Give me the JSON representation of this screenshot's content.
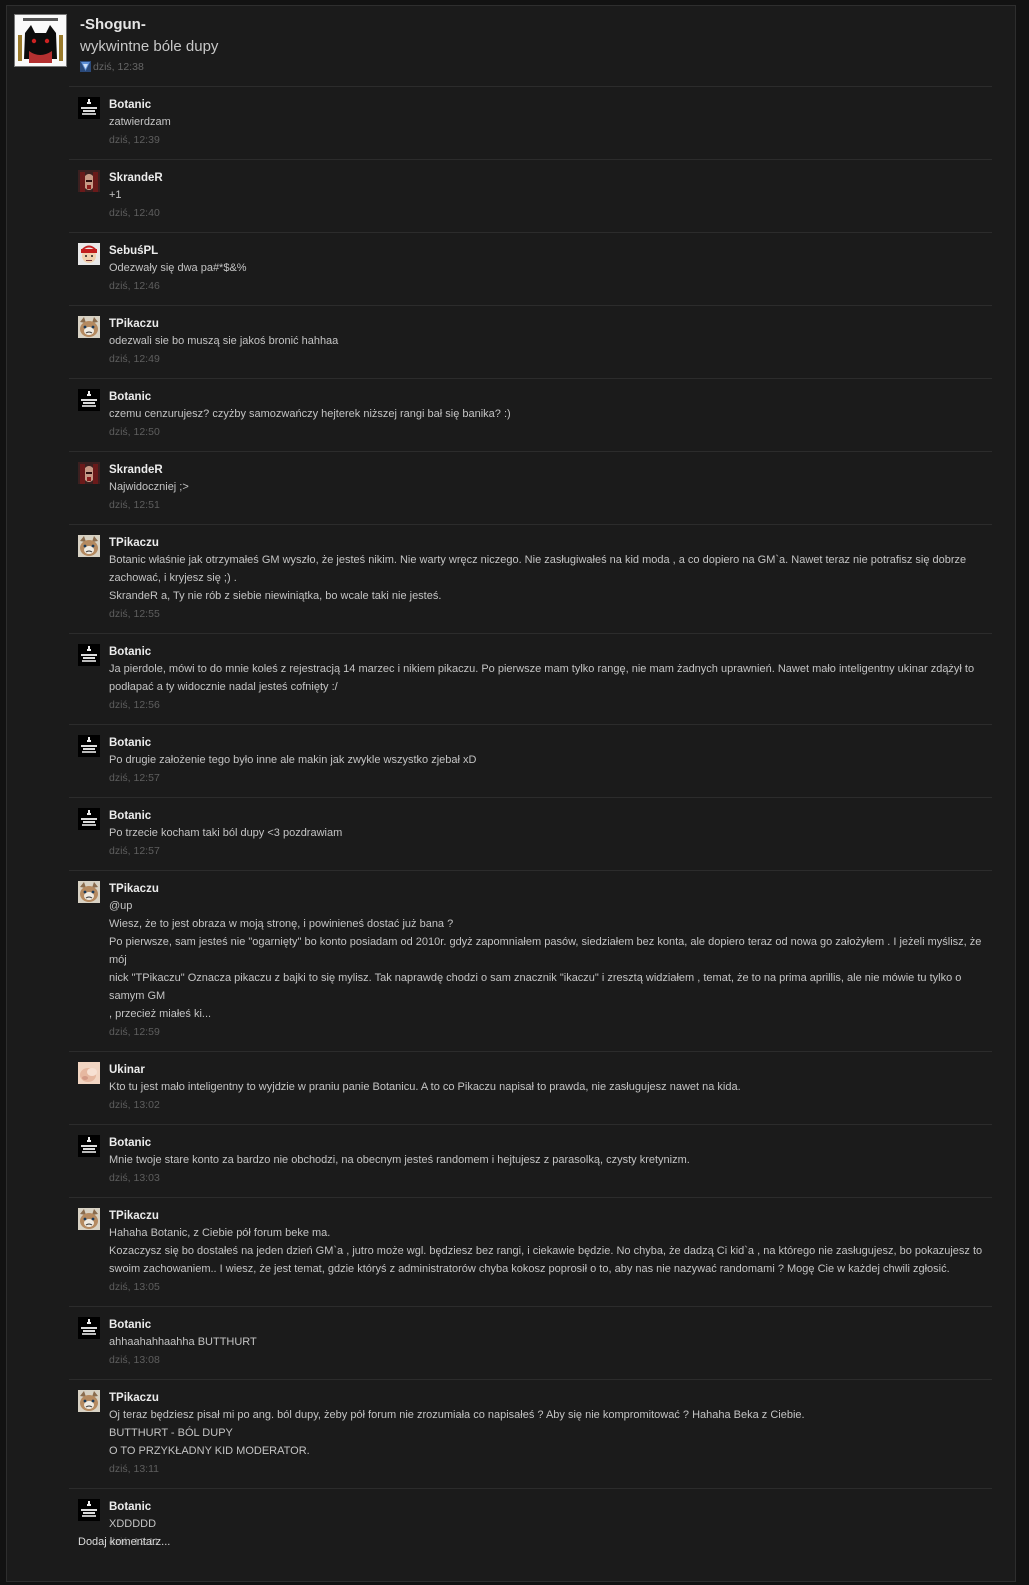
{
  "status": {
    "author": "-Shogun-",
    "text": "wykwintne bóle dupy",
    "time": "dziś, 12:38",
    "avatar_icon": "shogun-avatar-icon"
  },
  "comments": [
    {
      "author": "Botanic",
      "avatar": "botanic",
      "lines": [
        "zatwierdzam"
      ],
      "time": "dziś, 12:39"
    },
    {
      "author": "SkrandeR",
      "avatar": "skrander",
      "lines": [
        "+1"
      ],
      "time": "dziś, 12:40"
    },
    {
      "author": "SebuśPL",
      "avatar": "sebus",
      "lines": [
        "Odezwały się dwa pa#*$&%"
      ],
      "time": "dziś, 12:46"
    },
    {
      "author": "TPikaczu",
      "avatar": "tpikaczu",
      "lines": [
        "odezwali sie bo muszą sie jakoś bronić hahhaa"
      ],
      "time": "dziś, 12:49"
    },
    {
      "author": "Botanic",
      "avatar": "botanic",
      "lines": [
        "czemu cenzurujesz? czyżby samozwańczy hejterek niższej rangi bał się banika? :)"
      ],
      "time": "dziś, 12:50"
    },
    {
      "author": "SkrandeR",
      "avatar": "skrander",
      "lines": [
        "Najwidoczniej ;>"
      ],
      "time": "dziś, 12:51"
    },
    {
      "author": "TPikaczu",
      "avatar": "tpikaczu",
      "lines": [
        "Botanic właśnie jak otrzymałeś GM wyszło, że jesteś nikim. Nie warty wręcz niczego. Nie zasługiwałeś na kid moda , a co dopiero na GM`a. Nawet teraz nie potrafisz się dobrze",
        "zachować, i kryjesz się ;) .",
        "SkrandeR a, Ty nie rób z siebie niewiniątka, bo wcale taki nie jesteś."
      ],
      "time": "dziś, 12:55"
    },
    {
      "author": "Botanic",
      "avatar": "botanic",
      "lines": [
        "Ja pierdole, mówi to do mnie koleś z rejestracją 14 marzec i nikiem pikaczu. Po pierwsze mam tylko rangę, nie mam żadnych uprawnień. Nawet mało inteligentny ukinar zdążył to",
        "podłapać a ty widocznie nadal jesteś cofnięty :/"
      ],
      "time": "dziś, 12:56"
    },
    {
      "author": "Botanic",
      "avatar": "botanic",
      "lines": [
        "Po drugie założenie tego było inne ale makin jak zwykle wszystko zjebał xD"
      ],
      "time": "dziś, 12:57"
    },
    {
      "author": "Botanic",
      "avatar": "botanic",
      "lines": [
        "Po trzecie kocham taki ból dupy <3 pozdrawiam"
      ],
      "time": "dziś, 12:57"
    },
    {
      "author": "TPikaczu",
      "avatar": "tpikaczu",
      "lines": [
        "@up",
        "Wiesz, że to jest obraza w moją stronę, i powinieneś dostać już bana ?",
        "Po pierwsze, sam jesteś nie \"ogarnięty\" bo konto posiadam od 2010r. gdyż zapomniałem pasów, siedziałem bez konta, ale dopiero teraz od nowa go założyłem . I jeżeli myślisz, że mój",
        "nick \"TPikaczu\" Oznacza pikaczu z bajki to się mylisz. Tak naprawdę chodzi o sam znacznik \"ikaczu\" i zresztą widziałem , temat, że to na prima aprillis, ale nie mówie tu tylko o samym GM",
        ", przecież miałeś ki..."
      ],
      "time": "dziś, 12:59"
    },
    {
      "author": "Ukinar",
      "avatar": "ukinar",
      "lines": [
        "Kto tu jest mało inteligentny to wyjdzie w praniu panie Botanicu. A to co Pikaczu napisał to prawda, nie zasługujesz nawet na kida."
      ],
      "time": "dziś, 13:02"
    },
    {
      "author": "Botanic",
      "avatar": "botanic",
      "lines": [
        "Mnie twoje stare konto za bardzo nie obchodzi, na obecnym jesteś randomem i hejtujesz z parasolką, czysty kretynizm."
      ],
      "time": "dziś, 13:03"
    },
    {
      "author": "TPikaczu",
      "avatar": "tpikaczu",
      "lines": [
        "Hahaha Botanic, z Ciebie pół forum beke ma.",
        "Kozaczysz się bo dostałeś na jeden dzień GM`a , jutro może wgl. będziesz bez rangi, i ciekawie będzie. No chyba, że dadzą Ci kid`a , na którego nie zasługujesz, bo pokazujesz to",
        "swoim zachowaniem.. I wiesz, że jest temat, gdzie któryś z administratorów chyba kokosz poprosił o to, aby nas nie nazywać randomami ? Mogę Cie w każdej chwili zgłosić."
      ],
      "time": "dziś, 13:05"
    },
    {
      "author": "Botanic",
      "avatar": "botanic",
      "lines": [
        "ahhaahahhaahha BUTTHURT"
      ],
      "time": "dziś, 13:08"
    },
    {
      "author": "TPikaczu",
      "avatar": "tpikaczu",
      "lines": [
        "Oj teraz będziesz pisał mi po ang. ból dupy, żeby pół forum nie zrozumiała co napisałeś ? Aby się nie kompromitować ? Hahaha Beka z Ciebie.",
        "BUTTHURT - BÓL DUPY",
        "O TO PRZYKŁADNY KID MODERATOR."
      ],
      "time": "dziś, 13:11"
    },
    {
      "author": "Botanic",
      "avatar": "botanic",
      "lines": [
        "XDDDDD"
      ],
      "time": "dziś, 13:11"
    }
  ],
  "add_comment_label": "Dodaj komentarz..."
}
